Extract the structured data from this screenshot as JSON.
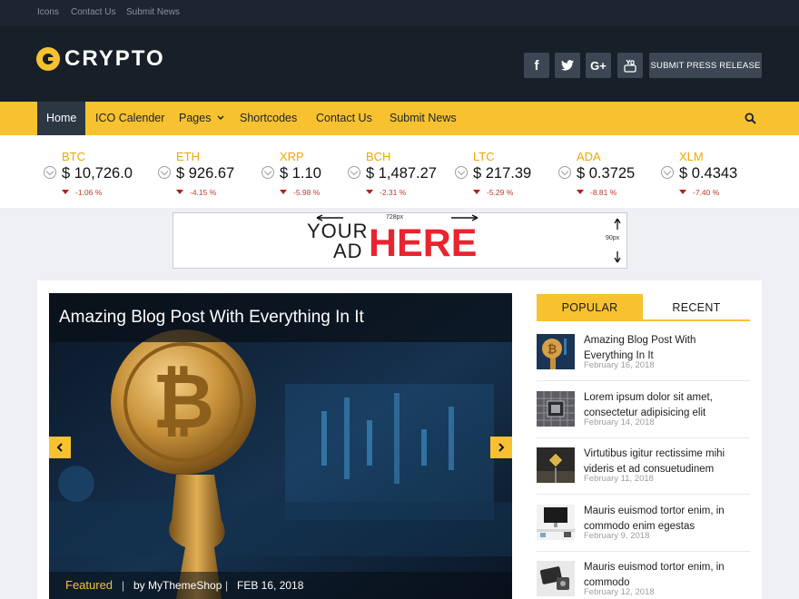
{
  "topbar": {
    "links": [
      "Icons",
      "Contact Us",
      "Submit News"
    ]
  },
  "header": {
    "logo_text": "CRYPTO",
    "social": [
      "f",
      "twitter-icon",
      "G+",
      "youtube-icon"
    ],
    "submit_press_release": "SUBMIT PRESS RELEASE"
  },
  "nav": {
    "items": [
      "Home",
      "ICO Calender",
      "Pages",
      "Shortcodes",
      "Contact Us",
      "Submit News"
    ],
    "active": "Home",
    "pages_has_dropdown": true
  },
  "ticker": {
    "coins": [
      {
        "symbol": "BTC",
        "price": "$ 10,726.0",
        "change": "-1.06 %"
      },
      {
        "symbol": "ETH",
        "price": "$ 926.67",
        "change": "-4.15 %"
      },
      {
        "symbol": "XRP",
        "price": "$ 1.10",
        "change": "-5.98 %"
      },
      {
        "symbol": "BCH",
        "price": "$ 1,487.27",
        "change": "-2.31 %"
      },
      {
        "symbol": "LTC",
        "price": "$ 217.39",
        "change": "-5.29 %"
      },
      {
        "symbol": "ADA",
        "price": "$ 0.3725",
        "change": "-8.81 %"
      },
      {
        "symbol": "XLM",
        "price": "$ 0.4343",
        "change": "-7.40 %"
      }
    ]
  },
  "ad": {
    "line1": "YOUR",
    "line2": "AD",
    "here": "HERE",
    "width_label": "728px",
    "height_label": "90px"
  },
  "slider": {
    "title": "Amazing Blog Post With Everything In It",
    "category": "Featured",
    "author": "by MyThemeShop",
    "date": "FEB 16, 2018",
    "separator": "|"
  },
  "sidebar": {
    "tabs": [
      "POPULAR",
      "RECENT"
    ],
    "active_tab": "POPULAR",
    "posts": [
      {
        "title": "Amazing Blog Post With Everything In It",
        "date": "February 16, 2018",
        "thumb": "bitcoin"
      },
      {
        "title": "Lorem ipsum dolor sit amet, consectetur adipisicing elit",
        "date": "February 14, 2018",
        "thumb": "chip"
      },
      {
        "title": "Virtutibus igitur rectissime mihi videris et ad consuetudinem",
        "date": "February 11, 2018",
        "thumb": "sign"
      },
      {
        "title": "Mauris euismod tortor enim, in commodo enim egestas",
        "date": "February 9, 2018",
        "thumb": "desk"
      },
      {
        "title": "Mauris euismod tortor enim, in commodo",
        "date": "February 12, 2018",
        "thumb": "device"
      }
    ]
  },
  "colors": {
    "accent": "#f8c12f",
    "header_bg": "#172029",
    "topbar_bg": "#1d2530",
    "nav_active": "#2c3744",
    "negative": "#c0392b"
  }
}
